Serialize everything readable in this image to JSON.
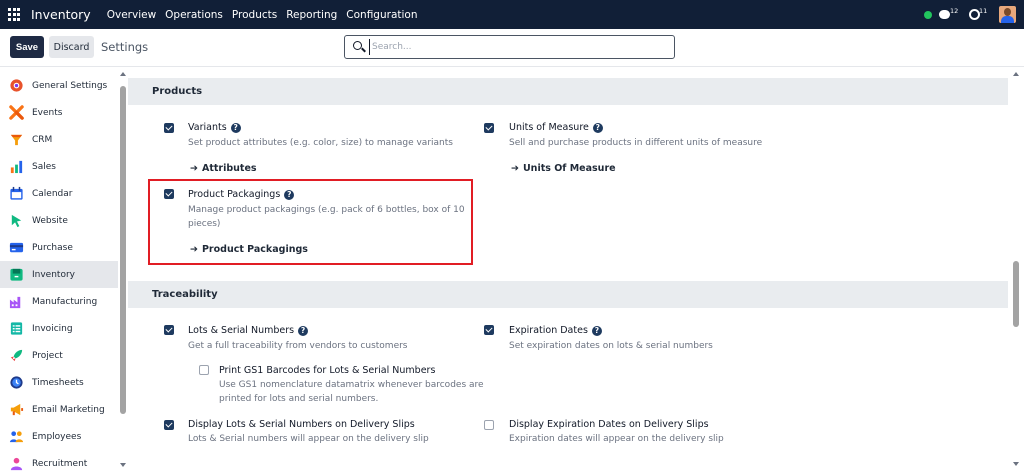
{
  "topbar": {
    "brand": "Inventory",
    "menu": [
      "Overview",
      "Operations",
      "Products",
      "Reporting",
      "Configuration"
    ],
    "chat_count": "12",
    "activity_count": "11",
    "status_color": "#22c55e"
  },
  "controlbar": {
    "save_label": "Save",
    "discard_label": "Discard",
    "title": "Settings",
    "search_placeholder": "Search..."
  },
  "sidebar": {
    "items": [
      {
        "label": "General Settings",
        "icon": "general-settings-icon",
        "active": false
      },
      {
        "label": "Events",
        "icon": "events-icon",
        "active": false
      },
      {
        "label": "CRM",
        "icon": "crm-icon",
        "active": false
      },
      {
        "label": "Sales",
        "icon": "sales-icon",
        "active": false
      },
      {
        "label": "Calendar",
        "icon": "calendar-icon",
        "active": false
      },
      {
        "label": "Website",
        "icon": "website-icon",
        "active": false
      },
      {
        "label": "Purchase",
        "icon": "purchase-icon",
        "active": false
      },
      {
        "label": "Inventory",
        "icon": "inventory-icon",
        "active": true
      },
      {
        "label": "Manufacturing",
        "icon": "manufacturing-icon",
        "active": false
      },
      {
        "label": "Invoicing",
        "icon": "invoicing-icon",
        "active": false
      },
      {
        "label": "Project",
        "icon": "project-icon",
        "active": false
      },
      {
        "label": "Timesheets",
        "icon": "timesheets-icon",
        "active": false
      },
      {
        "label": "Email Marketing",
        "icon": "email-marketing-icon",
        "active": false
      },
      {
        "label": "Employees",
        "icon": "employees-icon",
        "active": false
      },
      {
        "label": "Recruitment",
        "icon": "recruitment-icon",
        "active": false
      }
    ]
  },
  "sections": {
    "products": {
      "title": "Products",
      "variants": {
        "title": "Variants",
        "desc": "Set product attributes (e.g. color, size) to manage variants",
        "link": "Attributes",
        "checked": true
      },
      "uom": {
        "title": "Units of Measure",
        "desc": "Sell and purchase products in different units of measure",
        "link": "Units Of Measure",
        "checked": true
      },
      "packagings": {
        "title": "Product Packagings",
        "desc_line1": "Manage product packagings (e.g. pack of 6 bottles, box of 10",
        "desc_line2": "pieces)",
        "link": "Product Packagings",
        "checked": true
      }
    },
    "traceability": {
      "title": "Traceability",
      "lots": {
        "title": "Lots & Serial Numbers",
        "desc": "Get a full traceability from vendors to customers",
        "checked": true
      },
      "gs1": {
        "title": "Print GS1 Barcodes for Lots & Serial Numbers",
        "desc_line1": "Use GS1 nomenclature datamatrix whenever barcodes are",
        "desc_line2": "printed for lots and serial numbers.",
        "checked": false
      },
      "expiration": {
        "title": "Expiration Dates",
        "desc": "Set expiration dates on lots & serial numbers",
        "checked": true
      },
      "display_lots": {
        "title": "Display Lots & Serial Numbers on Delivery Slips",
        "desc": "Lots & Serial numbers will appear on the delivery slip",
        "checked": true
      },
      "display_exp": {
        "title": "Display Expiration Dates on Delivery Slips",
        "desc": "Expiration dates will appear on the delivery slip",
        "checked": false
      }
    }
  },
  "colors": {
    "navbar": "#111f37",
    "primary": "#1e3a5f",
    "highlight": "#e11d24"
  }
}
